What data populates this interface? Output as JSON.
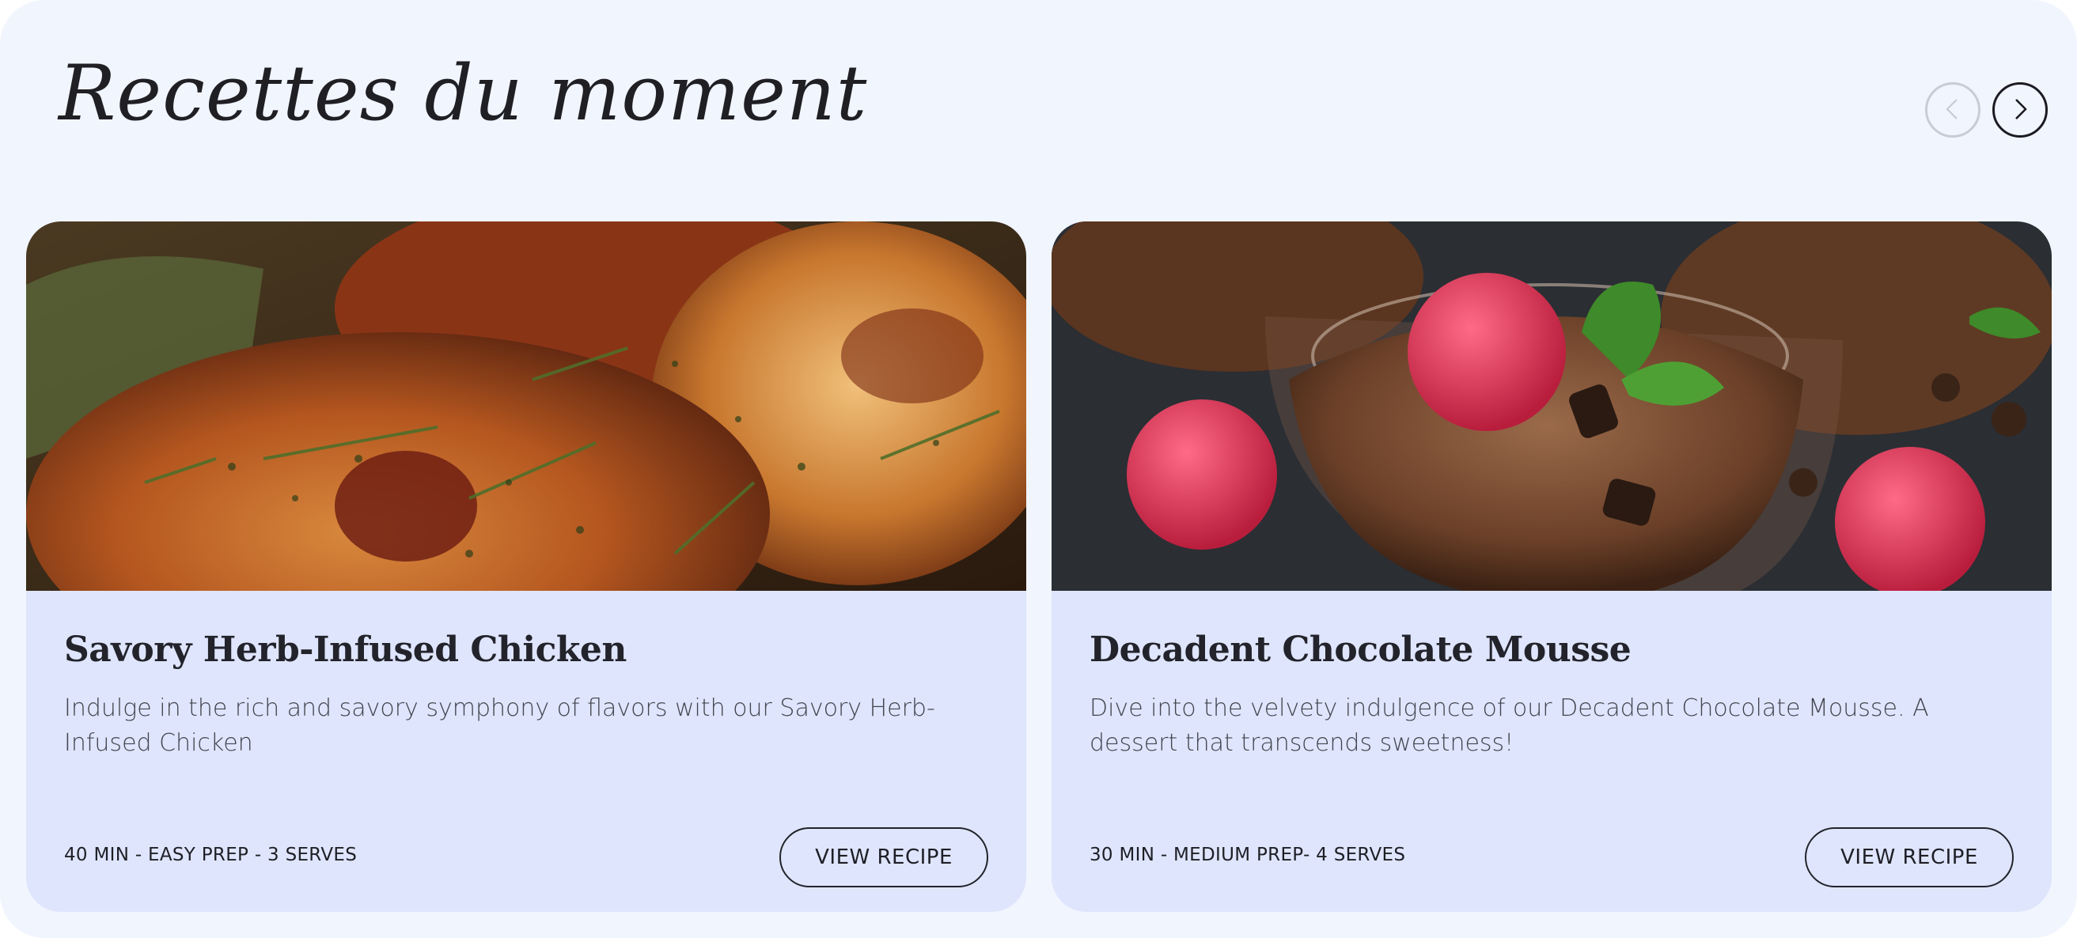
{
  "section": {
    "title": "Recettes du moment"
  },
  "nav": {
    "prev_icon": "chevron-left-icon",
    "next_icon": "chevron-right-icon"
  },
  "cards": [
    {
      "title": "Savory Herb-Infused Chicken",
      "description": "Indulge in the rich and savory symphony of flavors with our Savory Herb-Infused Chicken",
      "meta": "40 MIN - EASY PREP - 3 SERVES",
      "button_label": "VIEW RECIPE"
    },
    {
      "title": "Decadent Chocolate Mousse",
      "description": "Dive into the velvety indulgence of our Decadent Chocolate Mousse. A dessert that transcends sweetness!",
      "meta": "30 MIN - MEDIUM PREP- 4 SERVES",
      "button_label": "VIEW RECIPE"
    }
  ],
  "colors": {
    "panel_background": "#f1f5fe",
    "card_background": "#dfe5fc",
    "text_dark": "#1f1f24",
    "nav_disabled": "#c9ccd6"
  }
}
